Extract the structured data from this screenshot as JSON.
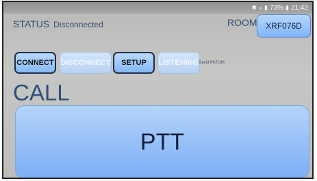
{
  "statusbar": {
    "bluetooth_icon": "bluetooth-icon",
    "wifi_icon": "wifi-icon",
    "signal_icon": "signal-icon",
    "battery_icon": "battery-icon",
    "battery": "73%",
    "time": "21:42"
  },
  "status": {
    "label": "STATUS",
    "value": "Disconnected"
  },
  "room": {
    "label": "ROOM",
    "value": "XRF076D"
  },
  "buttons": {
    "connect": "CONNECT",
    "disconnect": "DISCONNECT",
    "setup": "SETUP",
    "listening": "LISTENING"
  },
  "user": "David PA7LIM",
  "call_label": "CALL",
  "ptt_label": "PTT"
}
